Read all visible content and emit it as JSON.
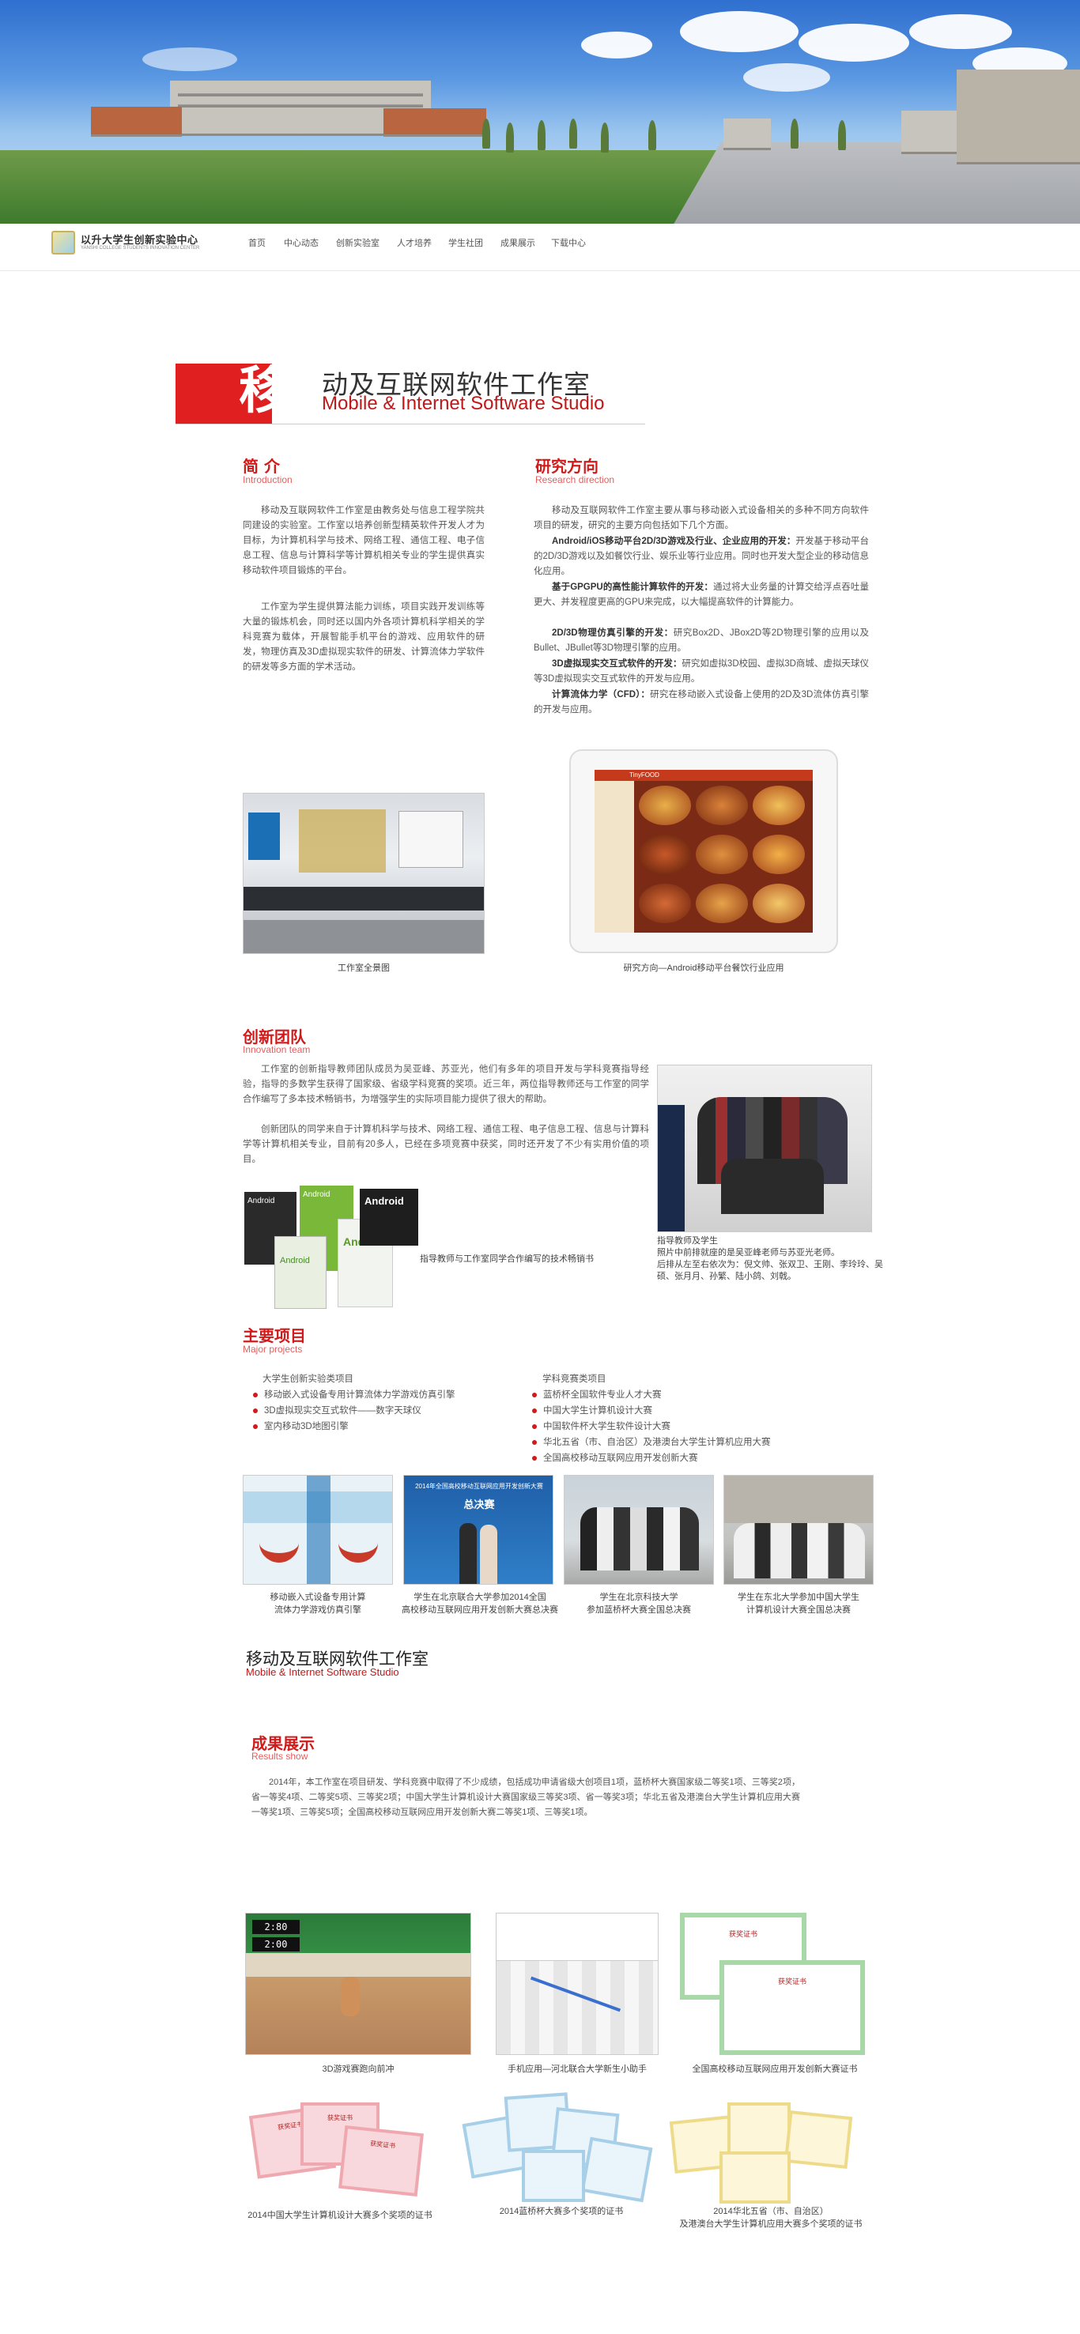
{
  "nav": {
    "logo_text": "以升大学生创新实验中心",
    "logo_sub": "YANSHI COLLEGE STUDENTS INNOVATION CENTER",
    "links": [
      "首页",
      "中心动态",
      "创新实验室",
      "人才培养",
      "学生社团",
      "成果展示",
      "下载中心"
    ]
  },
  "header": {
    "title_char": "移",
    "title_cn": "动及互联网软件工作室",
    "title_en": "Mobile & Internet Software Studio"
  },
  "intro": {
    "title_cn": "简 介",
    "title_en": "Introduction",
    "p1": "移动及互联网软件工作室是由教务处与信息工程学院共同建设的实验室。工作室以培养创新型精英软件开发人才为目标，为计算机科学与技术、网络工程、通信工程、电子信息工程、信息与计算科学等计算机相关专业的学生提供真实移动软件项目锻炼的平台。",
    "p2": "工作室为学生提供算法能力训练，项目实践开发训练等大量的锻炼机会，同时还以国内外各项计算机科学相关的学科竞赛为载体，开展智能手机平台的游戏、应用软件的研发，物理仿真及3D虚拟现实软件的研发、计算流体力学软件的研发等多方面的学术活动。"
  },
  "research": {
    "title_cn": "研究方向",
    "title_en": "Research direction",
    "p1": "移动及互联网软件工作室主要从事与移动嵌入式设备相关的多种不同方向软件项目的研发，研究的主要方向包括如下几个方面。",
    "items": [
      {
        "head": "Android/iOS移动平台2D/3D游戏及行业、企业应用的开发：",
        "body": "开发基于移动平台的2D/3D游戏以及如餐饮行业、娱乐业等行业应用。同时也开发大型企业的移动信息化应用。"
      },
      {
        "head": "基于GPGPU的高性能计算软件的开发：",
        "body": "通过将大业务量的计算交给浮点吞吐量更大、并发程度更高的GPU来完成，以大幅提高软件的计算能力。"
      },
      {
        "head": "2D/3D物理仿真引擎的开发：",
        "body": "研究Box2D、JBox2D等2D物理引擎的应用以及Bullet、JBullet等3D物理引擎的应用。"
      },
      {
        "head": "3D虚拟现实交互式软件的开发：",
        "body": "研究如虚拟3D校园、虚拟3D商城、虚拟天球仪等3D虚拟现实交互式软件的开发与应用。"
      },
      {
        "head": "计算流体力学（CFD）：",
        "body": "研究在移动嵌入式设备上使用的2D及3D流体仿真引擎的开发与应用。"
      }
    ]
  },
  "photos1": {
    "cap_left": "工作室全景图",
    "cap_right": "研究方向—Android移动平台餐饮行业应用",
    "app_header": "TinyFOOD"
  },
  "team": {
    "title_cn": "创新团队",
    "title_en": "Innovation team",
    "p1": "工作室的创新指导教师团队成员为吴亚峰、苏亚光，他们有多年的项目开发与学科竞赛指导经验，指导的多数学生获得了国家级、省级学科竞赛的奖项。近三年，两位指导教师还与工作室的同学合作编写了多本技术畅销书，为增强学生的实际项目能力提供了很大的帮助。",
    "p2": "创新团队的同学来自于计算机科学与技术、网络工程、通信工程、电子信息工程、信息与计算科学等计算机相关专业，目前有20多人，已经在多项竞赛中获奖，同时还开发了不少有实用价值的项目。",
    "books_caption": "指导教师与工作室同学合作编写的技术畅销书",
    "book_title": "Android",
    "group_caption": "指导教师及学生\n照片中前排就座的是吴亚峰老师与苏亚光老师。\n后排从左至右依次为：倪文帅、张双卫、王刚、李玲玲、吴硕、张月月、孙繁、陆小鸽、刘戟。"
  },
  "projects": {
    "title_cn": "主要项目",
    "title_en": "Major projects",
    "left_head": "大学生创新实验类项目",
    "left_items": [
      "移动嵌入式设备专用计算流体力学游戏仿真引擎",
      "3D虚拟现实交互式软件——数字天球仪",
      "室内移动3D地图引擎"
    ],
    "right_head": "学科竞赛类项目",
    "right_items": [
      "蓝桥杯全国软件专业人才大赛",
      "中国大学生计算机设计大赛",
      "中国软件杯大学生软件设计大赛",
      "华北五省（市、自治区）及港澳台大学生计算机应用大赛",
      "全国高校移动互联网应用开发创新大赛"
    ],
    "photo_caps": [
      "移动嵌入式设备专用计算\n流体力学游戏仿真引擎",
      "学生在北京联合大学参加2014全国\n高校移动互联网应用开发创新大赛总决赛",
      "学生在北京科技大学\n参加蓝桥杯大赛全国总决赛",
      "学生在东北大学参加中国大学生\n计算机设计大赛全国总决赛"
    ],
    "banner_text": "2014年全国高校移动互联网应用开发创新大赛",
    "banner_sub": "总决赛"
  },
  "studio2": {
    "title_cn": "移动及互联网软件工作室",
    "title_en": "Mobile & Internet Software Studio"
  },
  "results": {
    "title_cn": "成果展示",
    "title_en": "Results show",
    "p1": "2014年，本工作室在项目研发、学科竞赛中取得了不少成绩，包括成功申请省级大创项目1项，蓝桥杯大赛国家级二等奖1项、三等奖2项，省一等奖4项、二等奖5项、三等奖2项；中国大学生计算机设计大赛国家级三等奖3项、省一等奖3项；华北五省及港澳台大学生计算机应用大赛一等奖1项、三等奖5项；全国高校移动互联网应用开发创新大赛二等奖1项、三等奖1项。",
    "caps": [
      "3D游戏赛跑向前冲",
      "手机应用—河北联合大学新生小助手",
      "全国高校移动互联网应用开发创新大赛证书",
      "2014中国大学生计算机设计大赛多个奖项的证书",
      "2014蓝桥杯大赛多个奖项的证书",
      "2014华北五省（市、自治区）\n及港澳台大学生计算机应用大赛多个奖项的证书"
    ],
    "game_hud_top": "2:80",
    "game_hud_bot": "2:00",
    "cert_text": "获奖证书"
  },
  "colors": {
    "accent": "#d11a1a",
    "title_bar": "#e02020"
  }
}
